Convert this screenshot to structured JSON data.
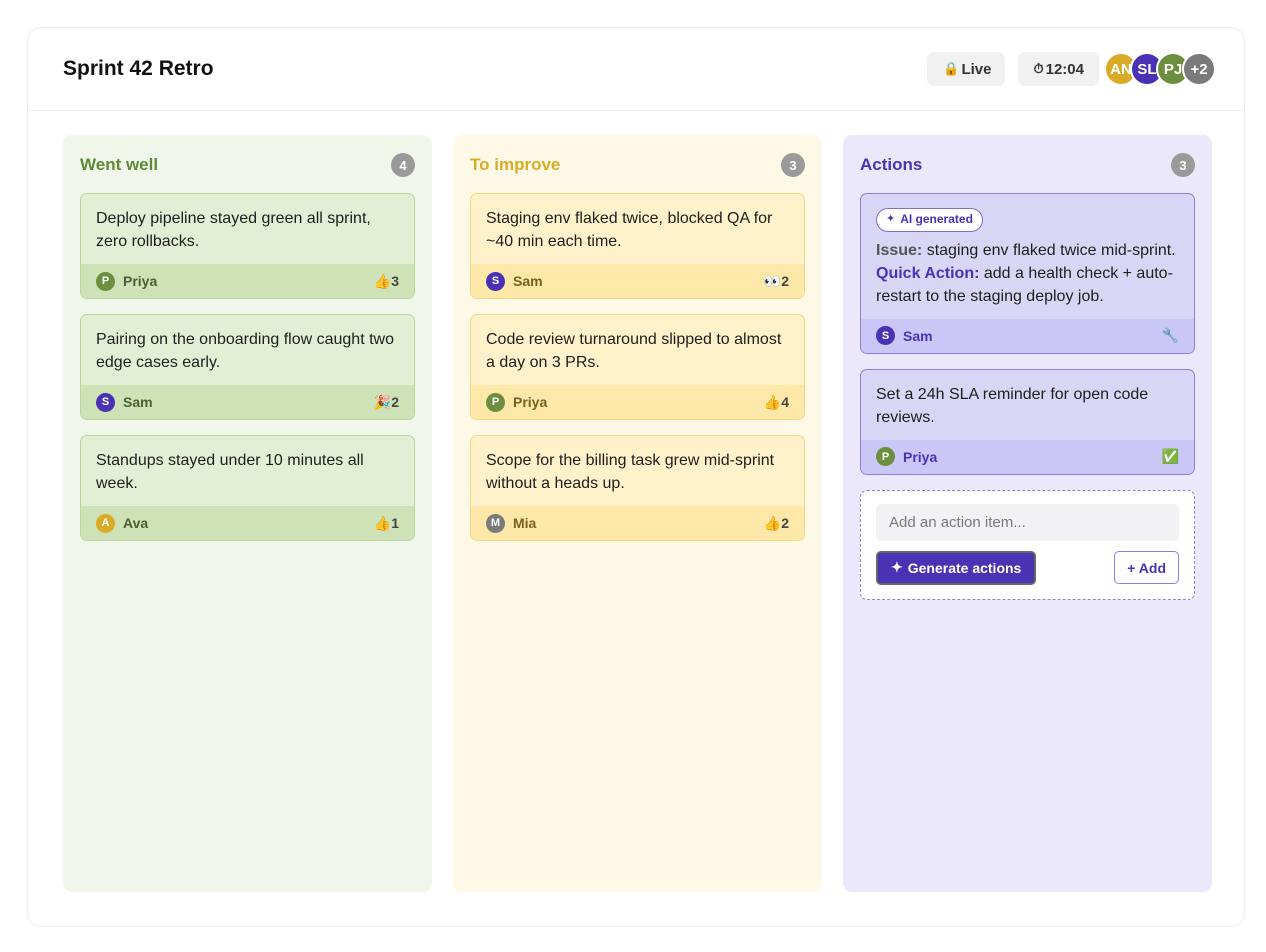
{
  "board": {
    "title": "Sprint 42 Retro",
    "live_label": "Live",
    "live_icon": "🔒",
    "timer": "12:04",
    "timer_icon": "⏱",
    "participants": [
      {
        "initials": "AN",
        "color": "#d8ac26"
      },
      {
        "initials": "SL",
        "color": "#4a32b5"
      },
      {
        "initials": "PJ",
        "color": "#6b8f3e"
      },
      {
        "initials": "+2",
        "color": "#7a7a7a"
      }
    ]
  },
  "columns": {
    "went_well": {
      "title": "Went well",
      "count": "4",
      "cards": [
        {
          "text": "Deploy pipeline stayed green all sprint, zero rollbacks.",
          "author": "Priya",
          "initial": "P",
          "avatar_color": "#6b8f3e",
          "reaction": "👍3"
        },
        {
          "text": "Pairing on the onboarding flow caught two edge cases early.",
          "author": "Sam",
          "initial": "S",
          "avatar_color": "#4a32b5",
          "reaction": "🎉2"
        },
        {
          "text": "Standups stayed under 10 minutes all week.",
          "author": "Ava",
          "initial": "A",
          "avatar_color": "#d8ac26",
          "reaction": "👍1"
        }
      ]
    },
    "to_improve": {
      "title": "To improve",
      "count": "3",
      "cards": [
        {
          "text": "Staging env flaked twice, blocked QA for ~40 min each time.",
          "author": "Sam",
          "initial": "S",
          "avatar_color": "#4a32b5",
          "reaction": "👀2"
        },
        {
          "text": "Code review turnaround slipped to almost a day on 3 PRs.",
          "author": "Priya",
          "initial": "P",
          "avatar_color": "#6b8f3e",
          "reaction": "👍4"
        },
        {
          "text": "Scope for the billing task grew mid-sprint without a heads up.",
          "author": "Mia",
          "initial": "M",
          "avatar_color": "#7a7a7a",
          "reaction": "👍2"
        }
      ]
    },
    "actions": {
      "title": "Actions",
      "count": "3",
      "ai_card": {
        "badge": "AI generated",
        "issue_label": "Issue:",
        "issue_text": " staging env flaked twice mid-sprint.",
        "action_label": "Quick Action:",
        "action_text": " add a health check + auto-restart to the staging deploy job.",
        "author": "Sam",
        "initial": "S",
        "avatar_color": "#4a32b5",
        "status_icon": "🔧"
      },
      "cards": [
        {
          "text": "Set a 24h SLA reminder for open code reviews.",
          "author": "Priya",
          "initial": "P",
          "avatar_color": "#6b8f3e",
          "status_icon": "✅"
        }
      ],
      "composer": {
        "placeholder": "Add an action item...",
        "value": "",
        "generate_label": "Generate actions",
        "add_label": "+ Add"
      }
    }
  },
  "colors": {
    "went_well_accent": "#5e8a36",
    "to_improve_accent": "#d8ac26",
    "actions_accent": "#4a32b5"
  }
}
